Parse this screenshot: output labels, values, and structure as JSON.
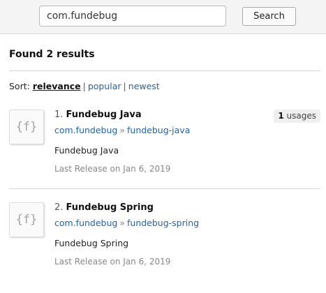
{
  "search": {
    "value": "com.fundebug",
    "placeholder": "",
    "button_label": "Search"
  },
  "results_heading": "Found 2 results",
  "sort": {
    "label": "Sort:",
    "options": [
      "relevance",
      "popular",
      "newest"
    ],
    "separator": "|",
    "active": "relevance"
  },
  "results": [
    {
      "index": "1.",
      "name": "Fundebug Java",
      "icon_text": "{f}",
      "usages_count": "1",
      "usages_label": "usages",
      "group": "com.fundebug",
      "arrow": "»",
      "artifact": "fundebug-java",
      "description": "Fundebug Java",
      "release": "Last Release on Jan 6, 2019"
    },
    {
      "index": "2.",
      "name": "Fundebug Spring",
      "icon_text": "{f}",
      "group": "com.fundebug",
      "arrow": "»",
      "artifact": "fundebug-spring",
      "description": "Fundebug Spring",
      "release": "Last Release on Jan 6, 2019"
    }
  ],
  "colors": {
    "link": "#2563a6",
    "muted": "#888888",
    "topbar": "#f4f4f4"
  }
}
